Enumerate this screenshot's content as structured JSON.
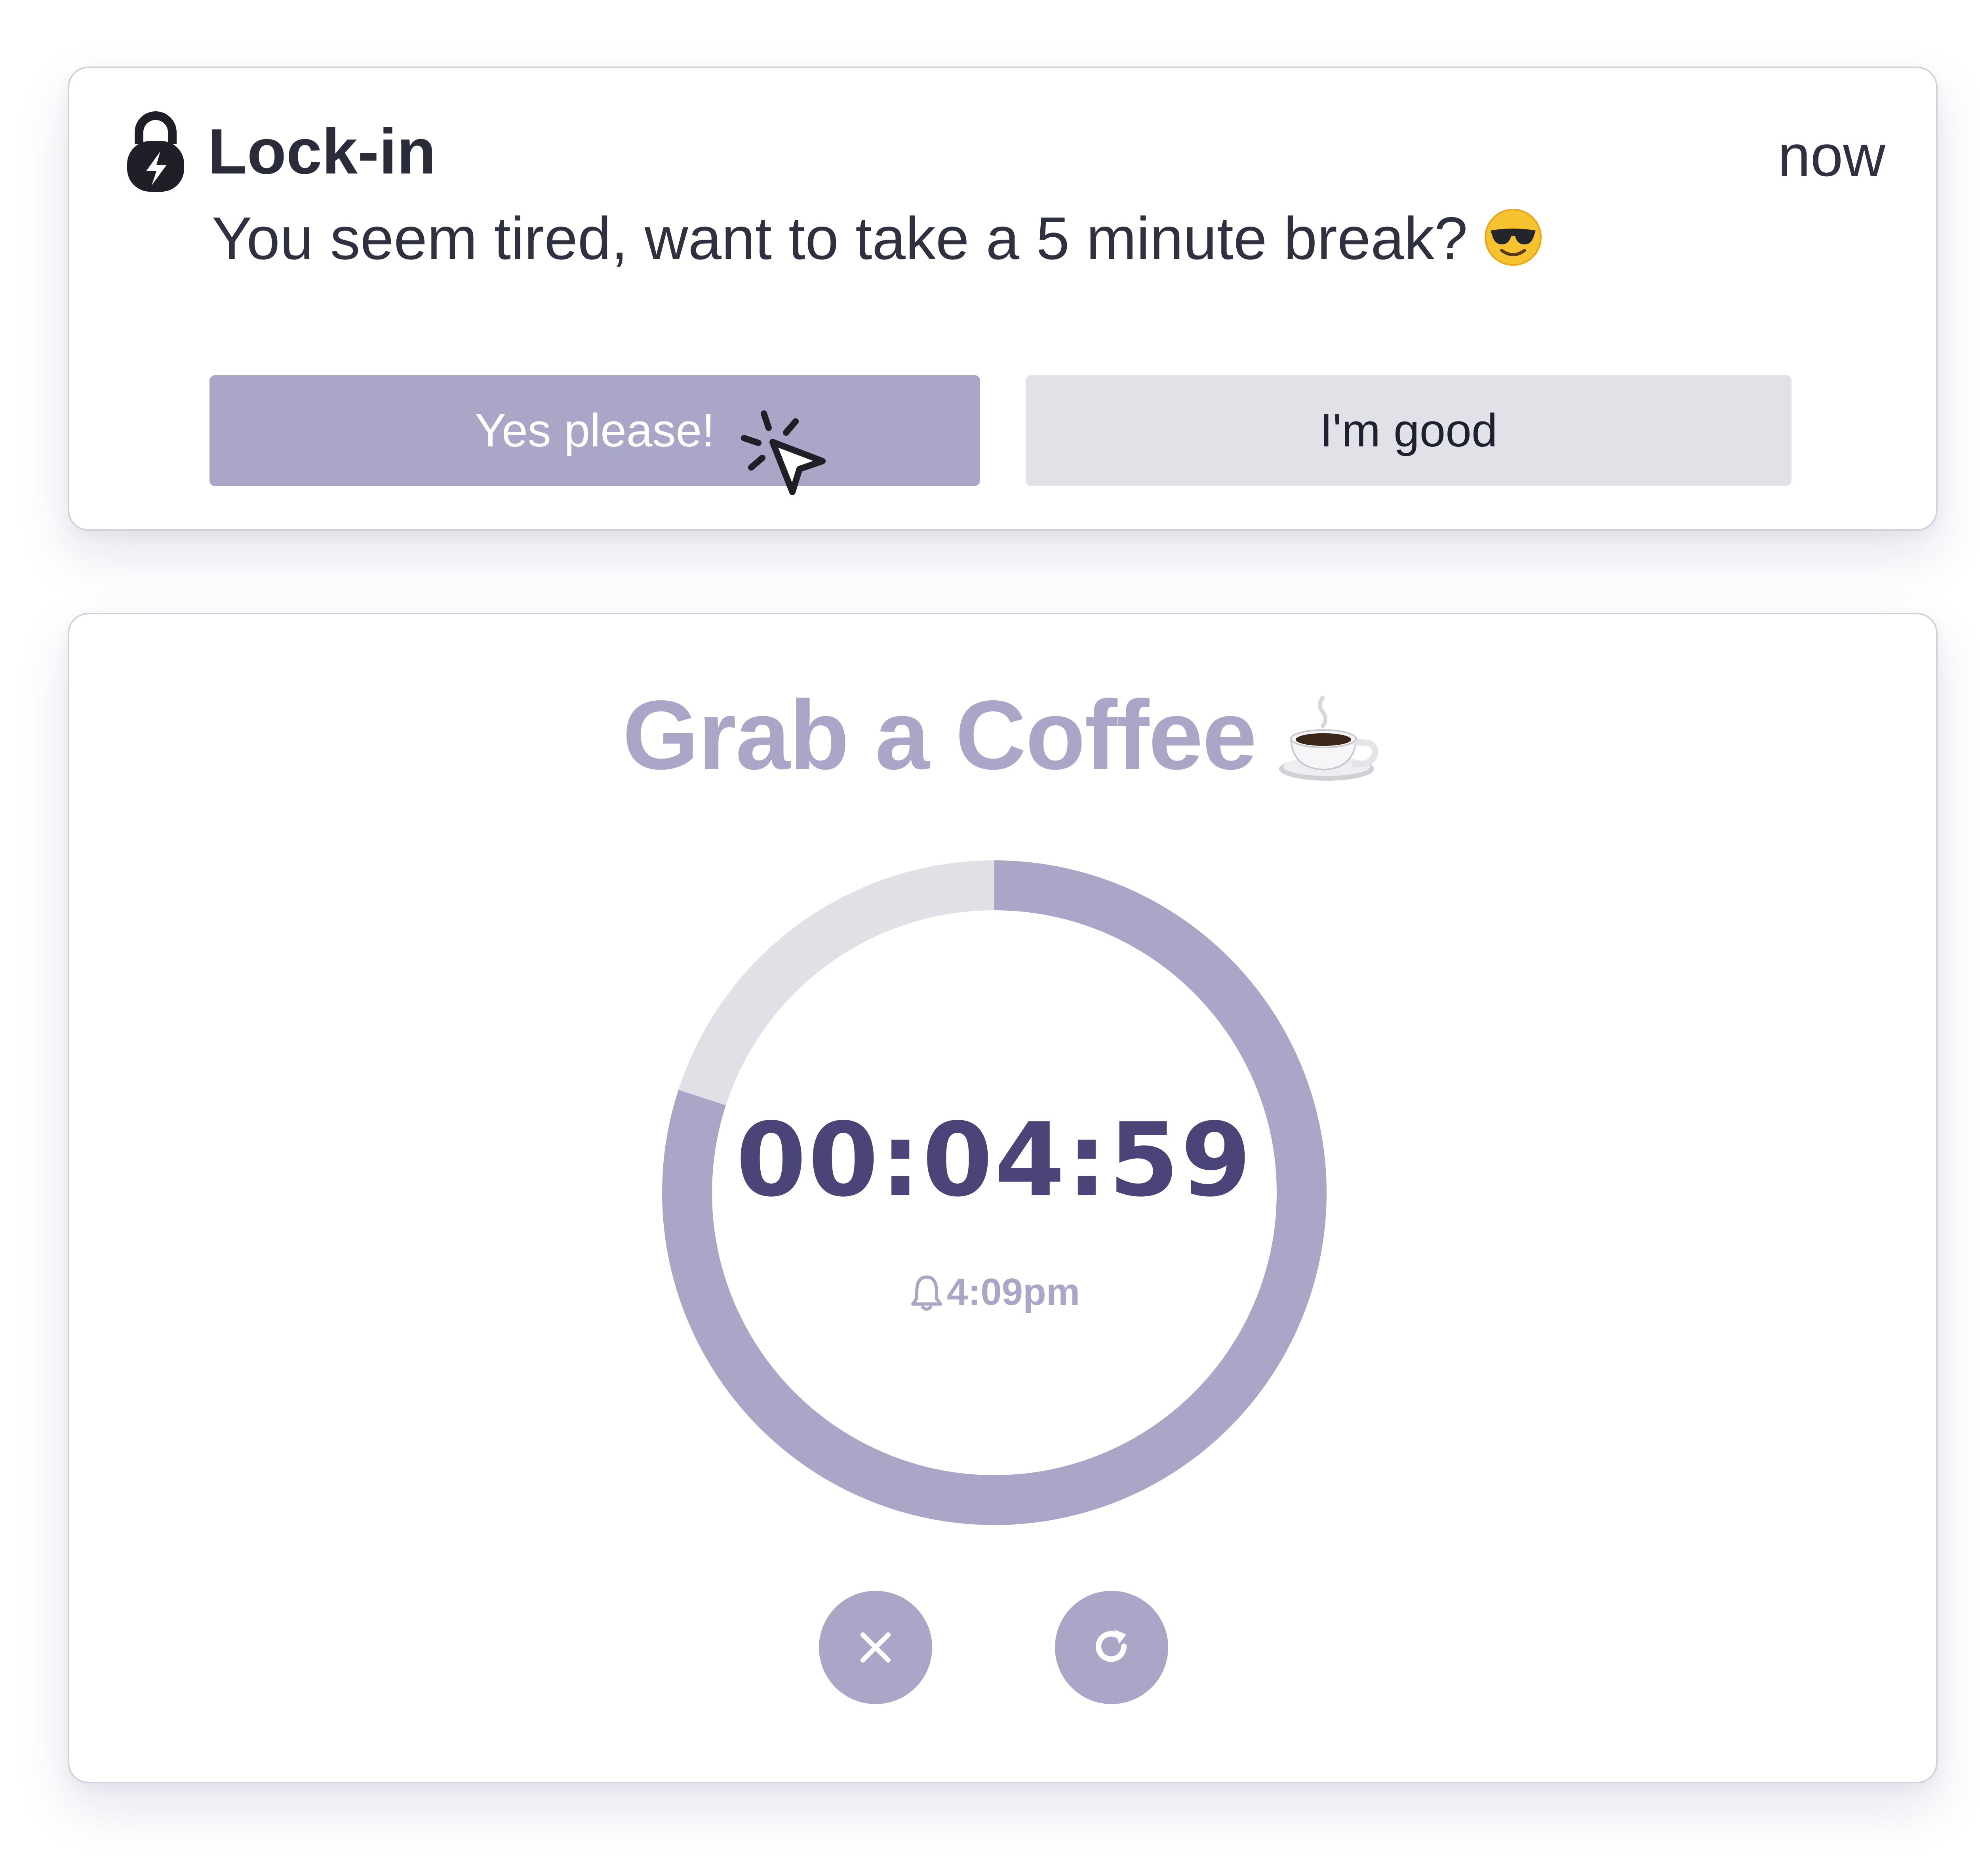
{
  "notification": {
    "app_name": "Lock-in",
    "time": "now",
    "message": "You seem tired, want to take a 5 minute break?",
    "message_emoji": "smiling-face-with-sunglasses",
    "app_icon": "lock-lightning-icon",
    "primary_button": "Yes please!",
    "secondary_button": "I'm good",
    "cursor_icon": "click-cursor-icon"
  },
  "timer": {
    "title": "Grab a Coffee",
    "title_icon": "coffee-cup-icon",
    "countdown": "00:04:59",
    "alarm_time": "4:09pm",
    "alarm_icon": "bell-icon",
    "progress_remaining": 0.8,
    "cancel_icon": "close-icon",
    "reset_icon": "reset-icon"
  },
  "colors": {
    "accent": "#a9a6c8",
    "track": "#dfe1e6",
    "countdown_text": "#4a4478",
    "secondary_button_bg": "#e0e2e7"
  }
}
